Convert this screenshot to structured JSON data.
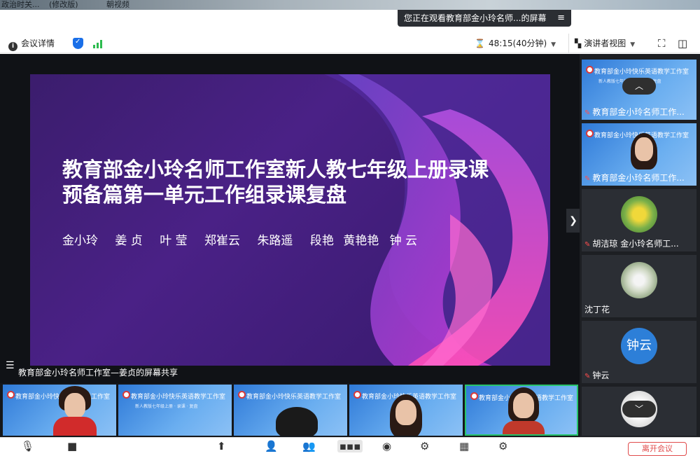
{
  "background_window": {
    "fragments": [
      "政治时关...",
      "(修改版)",
      "朝视频"
    ]
  },
  "share_banner": {
    "text": "您正在观看教育部金小玲名师...的屏幕",
    "menu_icon": "≡"
  },
  "top_toolbar": {
    "meeting_details": "会议详情",
    "timer": "48:15(40分钟)",
    "view_mode": "演讲者视图"
  },
  "slide": {
    "title_line1": "教育部金小玲名师工作室新人教七年级上册录课",
    "title_line2": "预备篇第一单元工作组录课复盘",
    "authors": [
      "金小玲",
      "姜 贞",
      "叶 莹",
      "郑崔云",
      "朱路遥",
      "段艳",
      "黄艳艳",
      "钟 云"
    ]
  },
  "screen_share_label": "教育部金小玲名师工作室—姜贞的屏幕共享",
  "mini_slide_text": {
    "title": "教育部金小玲快乐英语教学工作室",
    "subtitle": "新人教版七年级上册 · 录课 · 复盘"
  },
  "right_participants": [
    {
      "name": "教育部金小玲名师工作..."
    },
    {
      "name": "教育部金小玲名师工作..."
    },
    {
      "name": "胡洁琼 金小玲名师工..."
    },
    {
      "name": "沈丁花"
    },
    {
      "name": "钟云",
      "avatar_text": "钟云"
    }
  ],
  "colors": {
    "accent_blue": "#1a6fe8",
    "avatar_blue": "#2d7fd8",
    "active_speaker": "#27c46b",
    "leave_red": "#e04a4a"
  },
  "leave_button": "离开会议"
}
